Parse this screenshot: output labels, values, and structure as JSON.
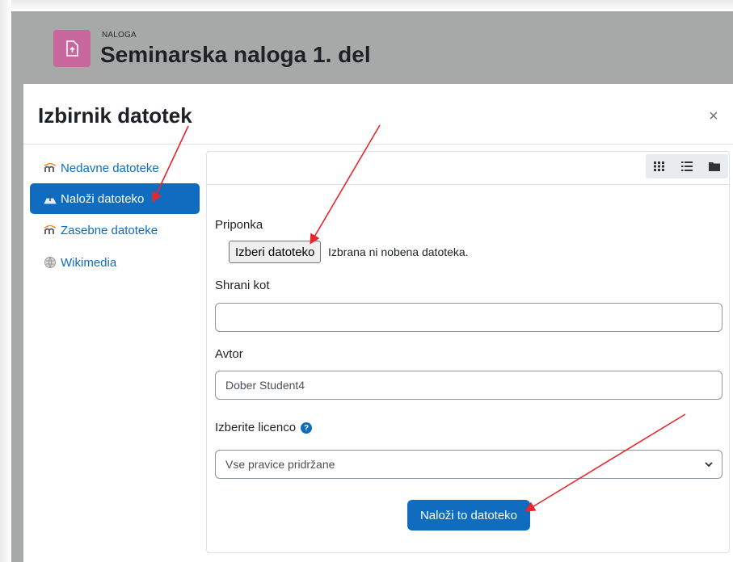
{
  "header": {
    "kicker": "NALOGA",
    "title": "Seminarska naloga 1. del",
    "icon": "file-upload-icon",
    "icon_color": "#c7679c"
  },
  "modal": {
    "title": "Izbirnik datotek",
    "close_symbol": "×"
  },
  "sidebar": {
    "items": [
      {
        "label": "Nedavne datoteke",
        "icon": "moodle-icon",
        "active": false
      },
      {
        "label": "Naloži datoteko",
        "icon": "upload-icon",
        "active": true
      },
      {
        "label": "Zasebne datoteke",
        "icon": "moodle-icon",
        "active": false
      },
      {
        "label": "Wikimedia",
        "icon": "wikimedia-icon",
        "active": false
      }
    ]
  },
  "toolbar": {
    "views": [
      "grid-view-icon",
      "list-view-icon",
      "folder-view-icon"
    ]
  },
  "form": {
    "attachment_label": "Priponka",
    "choose_file_label": "Izberi datoteko",
    "file_status": "Izbrana ni nobena datoteka.",
    "save_as_label": "Shrani kot",
    "save_as_value": "",
    "author_label": "Avtor",
    "author_value": "Dober Student4",
    "license_label": "Izberite licenco",
    "license_value": "Vse pravice pridržane",
    "upload_button": "Naloži to datoteko"
  },
  "colors": {
    "primary": "#0f6cbf",
    "annotation_arrow": "#e8252a",
    "moodle_orange": "#f98012"
  }
}
